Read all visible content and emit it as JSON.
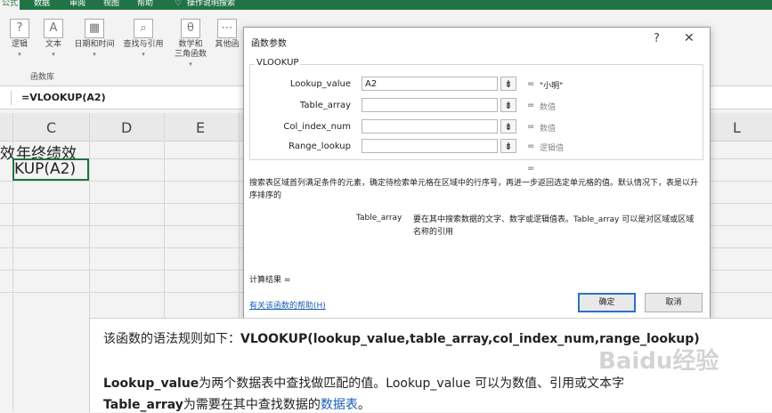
{
  "ribbon": {
    "tabs": [
      {
        "label": "公式",
        "active": true
      },
      {
        "label": "数据"
      },
      {
        "label": "审阅"
      },
      {
        "label": "视图"
      },
      {
        "label": "帮助"
      },
      {
        "label": "操作说明搜索"
      }
    ],
    "buttons": [
      "逻辑",
      "文本",
      "日期和时间",
      "查找与引用",
      "数学和",
      "其他函"
    ],
    "math_line2": "三角函数",
    "group_label": "函数库"
  },
  "formula_bar": {
    "text": "=VLOOKUP(A2)"
  },
  "grid": {
    "columns": [
      "C",
      "D",
      "E",
      "L"
    ],
    "cell_left": "效",
    "cell_c": "年终绩效",
    "cell_edit": "KUP(A2)"
  },
  "dialog": {
    "title": "函数参数",
    "help": "?",
    "close": "✕",
    "function_name": "VLOOKUP",
    "args": [
      {
        "label": "Lookup_value",
        "value": "A2",
        "result": "\"小明\""
      },
      {
        "label": "Table_array",
        "value": "",
        "result": "数值"
      },
      {
        "label": "Col_index_num",
        "value": "",
        "result": "数值"
      },
      {
        "label": "Range_lookup",
        "value": "",
        "result": "逻辑值"
      }
    ],
    "equals": "=",
    "description": "搜索表区域首列满足条件的元素，确定待检索单元格在区域中的行序号，再进一步返回选定单元格的值。默认情况下，表是以升序排序的",
    "detail_name": "Table_array",
    "detail_text": "要在其中搜索数据的文字、数字或逻辑值表。Table_array 可以是对区域或区域名称的引用",
    "result_label": "计算结果 =",
    "help_link": "有关该函数的帮助(H)",
    "ok": "确定",
    "cancel": "取消"
  },
  "tip": {
    "line1_prefix": "该函数的语法规则如下：",
    "line1_bold": "VLOOKUP(lookup_value,table_array,col_index_num,range_lookup)",
    "line2_bold": "Lookup_value",
    "line2_text": "为两个数据表中查找做匹配的值。Lookup_value 可以为数值、引用或文本字",
    "line3_bold": "Table_array",
    "line3_text": "为需要在其中查找数据的",
    "line3_link": "数据表",
    "line3_end": "。"
  },
  "watermark": "Baidu经验"
}
